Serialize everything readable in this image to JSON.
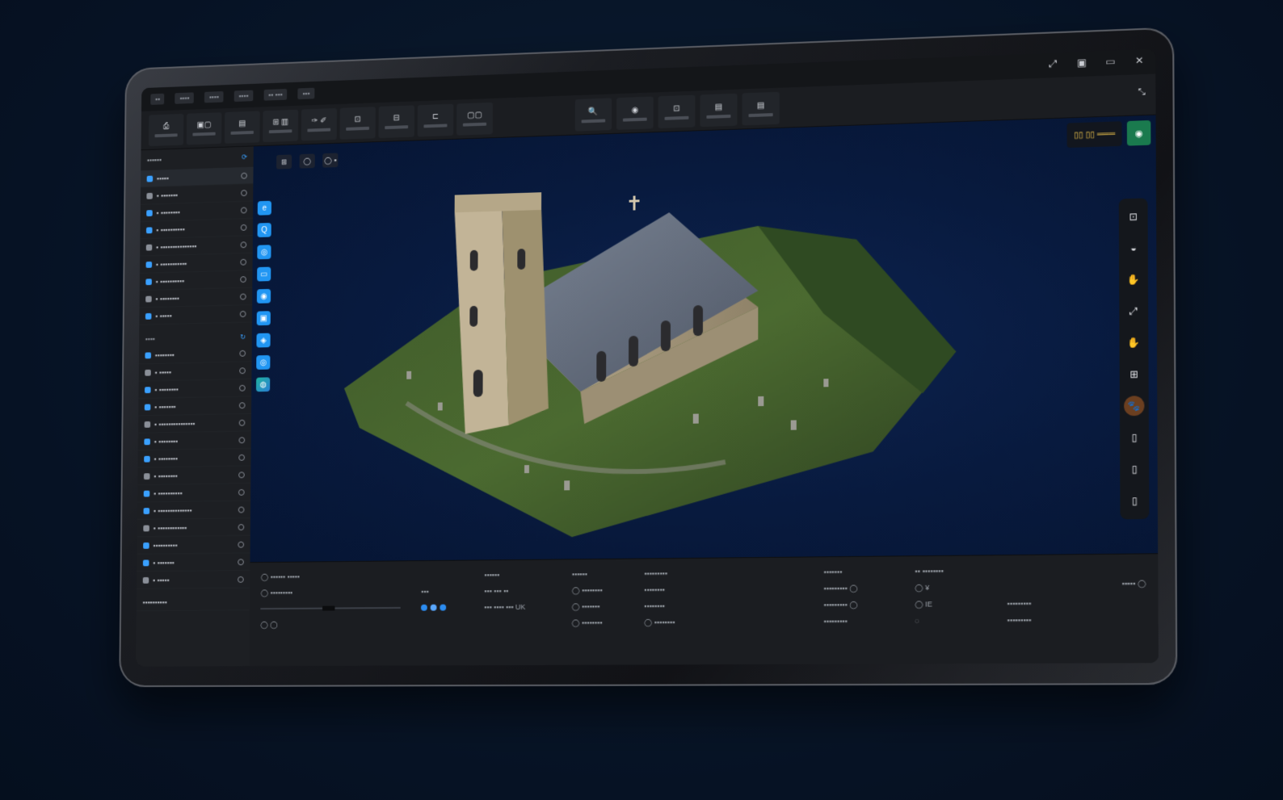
{
  "window": {
    "controls": [
      "⤢",
      "▣",
      "▭",
      "✕"
    ],
    "expand_icon": "⤡"
  },
  "menu": {
    "items": [
      "▪▪",
      "▪▪▪▪",
      "▪▪▪▪",
      "▪▪▪▪",
      "▪▪ ▪▪▪",
      "▪▪▪"
    ]
  },
  "toolbar": {
    "left_tools": [
      "⎙",
      "▣▢",
      "▤",
      "⊞ ▥",
      "✑ ✐",
      "⊡",
      "⊟",
      "⊏",
      "▢▢"
    ],
    "center_tools": [
      "🔍",
      "◉",
      "⊡",
      "▤",
      "▤"
    ]
  },
  "left_panel": {
    "header_label": "▪▪▪▪▪▪",
    "tree": [
      {
        "label": "▪▪▪▪▪",
        "selected": true
      },
      {
        "label": "▪ ▪▪▪▪▪▪▪"
      },
      {
        "label": "▪ ▪▪▪▪▪▪▪▪"
      },
      {
        "label": "▪ ▪▪▪▪▪▪▪▪▪▪"
      },
      {
        "label": "▪ ▪▪▪▪▪▪▪▪▪▪▪▪▪▪▪"
      },
      {
        "label": "▪ ▪▪▪▪▪▪▪▪▪▪▪"
      },
      {
        "label": "▪ ▪▪▪▪▪▪▪▪▪▪"
      },
      {
        "label": "▪ ▪▪▪▪▪▪▪▪"
      },
      {
        "label": "▪ ▪▪▪▪▪"
      }
    ],
    "section2_label": "▪▪▪▪",
    "tree2": [
      {
        "label": "▪▪▪▪▪▪▪▪"
      },
      {
        "label": "▪ ▪▪▪▪▪"
      },
      {
        "label": "▪ ▪▪▪▪▪▪▪▪"
      },
      {
        "label": "▪ ▪▪▪▪▪▪▪"
      },
      {
        "label": "▪ ▪▪▪▪▪▪▪▪▪▪▪▪▪▪▪"
      },
      {
        "label": "▪ ▪▪▪▪▪▪▪▪"
      },
      {
        "label": "▪ ▪▪▪▪▪▪▪▪"
      },
      {
        "label": "▪ ▪▪▪▪▪▪▪▪"
      },
      {
        "label": "▪ ▪▪▪▪▪▪▪▪▪▪"
      },
      {
        "label": "▪ ▪▪▪▪▪▪▪▪▪▪▪▪▪▪"
      },
      {
        "label": "▪ ▪▪▪▪▪▪▪▪▪▪▪▪"
      },
      {
        "label": "▪▪▪▪▪▪▪▪▪▪"
      },
      {
        "label": "▪ ▪▪▪▪▪▪▪"
      },
      {
        "label": "▪ ▪▪▪▪▪"
      }
    ],
    "footer_label": "▪▪▪▪▪▪▪▪▪▪"
  },
  "vertical_strip": {
    "buttons": [
      "e",
      "Q",
      "◎",
      "▭",
      "◉",
      "▣",
      "◈",
      "◎",
      "◍"
    ]
  },
  "viewport": {
    "chips": [
      "⊞",
      "◯",
      "◯ ▪"
    ],
    "hud_text": "▯▯ ▯▯ ═══",
    "right_rail": [
      "⊡",
      "◒",
      "✋",
      "⤢",
      "✋",
      "⊞",
      "🐾",
      "▯",
      "▯",
      "▯"
    ]
  },
  "bottom_panel": {
    "col1_header": "◯ ▪▪▪▪▪▪ ▪▪▪▪▪",
    "col1_rows": [
      "◯ ▪▪▪▪▪▪▪▪▪",
      "◯ ◯"
    ],
    "col2_rows": [
      "▪▪▪▪▪▪",
      "▪▪▪ ▪▪▪ ▪▪",
      "▪▪▪ ▪▪▪▪ ▪▪▪ UK"
    ],
    "col3_rows": [
      "▪▪▪▪▪▪",
      "◯ ▪▪▪▪▪▪▪▪",
      "◯ ▪▪▪▪▪▪▪",
      "◯ ▪▪▪▪▪▪▪▪"
    ],
    "col4_rows": [
      "▪▪▪▪▪▪▪▪▪",
      "▪▪▪▪▪▪▪▪",
      "▪▪▪▪▪▪▪▪",
      "◯ ▪▪▪▪▪▪▪▪"
    ],
    "col5_rows": [
      "▪▪▪▪▪▪▪",
      "▪▪▪▪▪▪▪▪▪ ◯",
      "▪▪▪▪▪▪▪▪▪ ◯",
      "▪▪▪▪▪▪▪▪▪"
    ],
    "col6_header": "▪▪ ▪▪▪▪▪▪▪▪",
    "col6_rows": [
      "◯ ¥",
      "◯ IE",
      "◌"
    ],
    "col7_rows": [
      "▪▪▪▪▪▪▪▪▪",
      "▪▪▪▪▪▪▪▪▪"
    ],
    "right_header": "▪▪▪▪▪ ◯"
  },
  "colors": {
    "accent": "#2196f3",
    "hud_yellow": "#e9c04c",
    "hud_green": "#1a7a4e",
    "viewport_bg": "#081a3e"
  }
}
